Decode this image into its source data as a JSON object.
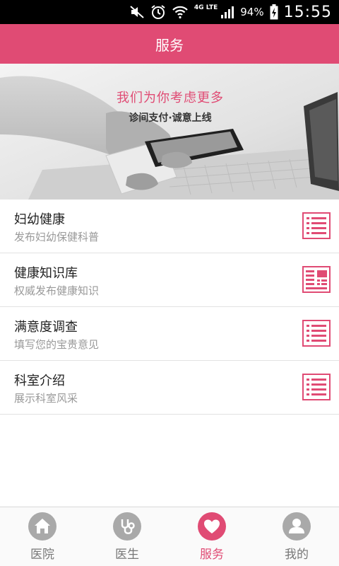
{
  "status_bar": {
    "network": "4G LTE",
    "battery": "94%",
    "time": "15:55"
  },
  "header": {
    "title": "服务"
  },
  "banner": {
    "slogan_main": "我们为你考虑更多",
    "slogan_sub": "诊间支付·诚意上线"
  },
  "services": [
    {
      "title": "妇幼健康",
      "desc": "发布妇幼保健科普",
      "icon": "list-icon"
    },
    {
      "title": "健康知识库",
      "desc": "权威发布健康知识",
      "icon": "newspaper-icon"
    },
    {
      "title": "满意度调查",
      "desc": "填写您的宝贵意见",
      "icon": "list-icon"
    },
    {
      "title": "科室介绍",
      "desc": "展示科室风采",
      "icon": "list-icon"
    }
  ],
  "bottom_nav": [
    {
      "label": "医院",
      "icon": "home-icon",
      "active": false
    },
    {
      "label": "医生",
      "icon": "stethoscope-icon",
      "active": false
    },
    {
      "label": "服务",
      "icon": "heart-icon",
      "active": true
    },
    {
      "label": "我的",
      "icon": "person-icon",
      "active": false
    }
  ],
  "colors": {
    "accent": "#e04b74",
    "inactive": "#a9a9a9"
  }
}
